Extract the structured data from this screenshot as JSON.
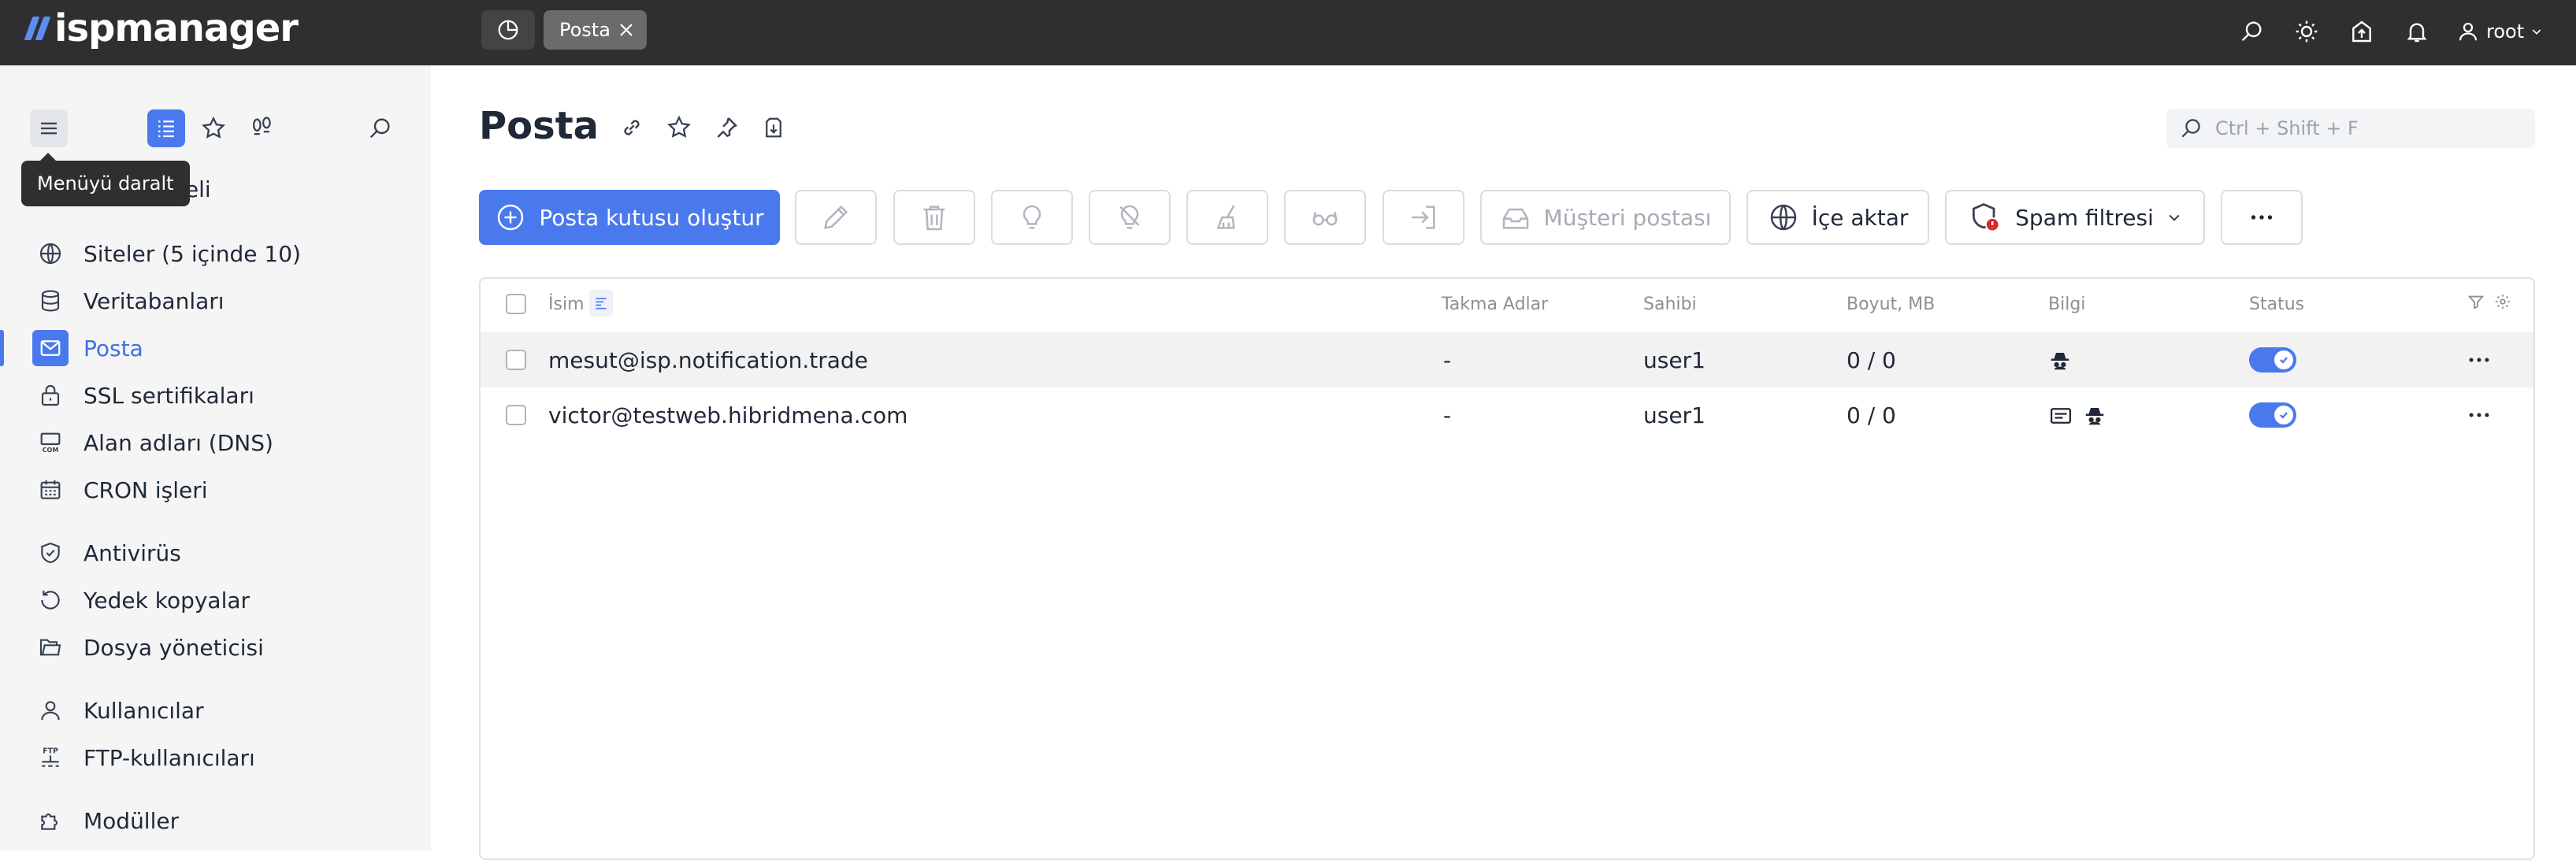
{
  "topbar": {
    "logo_text": "ispmanager",
    "active_tab": "Posta",
    "user_name": "root"
  },
  "sidebar": {
    "tooltip": "Menüyü daralt",
    "panel_label_partial": "aneli",
    "items": [
      {
        "label": "Siteler (5 içinde 10)",
        "icon": "globe-icon"
      },
      {
        "label": "Veritabanları",
        "icon": "database-icon"
      },
      {
        "label": "Posta",
        "icon": "mail-icon",
        "active": true
      },
      {
        "label": "SSL sertifikaları",
        "icon": "lock-icon"
      },
      {
        "label": "Alan adları (DNS)",
        "icon": "dns-icon"
      },
      {
        "label": "CRON işleri",
        "icon": "calendar-icon"
      },
      {
        "label": "Antivirüs",
        "icon": "shield-check-icon"
      },
      {
        "label": "Yedek kopyalar",
        "icon": "backup-icon"
      },
      {
        "label": "Dosya yöneticisi",
        "icon": "folder-icon"
      },
      {
        "label": "Kullanıcılar",
        "icon": "user-icon"
      },
      {
        "label": "FTP-kullanıcıları",
        "icon": "ftp-icon"
      },
      {
        "label": "Modüller",
        "icon": "puzzle-icon"
      }
    ]
  },
  "page": {
    "title": "Posta",
    "search_placeholder": "Ctrl + Shift + F"
  },
  "toolbar": {
    "create_label": "Posta kutusu oluştur",
    "client_mail_label": "Müşteri postası",
    "import_label": "İçe aktar",
    "spam_label": "Spam filtresi"
  },
  "table": {
    "headers": {
      "name": "İsim",
      "aliases": "Takma Adlar",
      "owner": "Sahibi",
      "size": "Boyut, MB",
      "info": "Bilgi",
      "status": "Status"
    },
    "rows": [
      {
        "name": "mesut@isp.notification.trade",
        "aliases": "-",
        "owner": "user1",
        "size": "0 / 0",
        "status_on": true
      },
      {
        "name": "victor@testweb.hibridmena.com",
        "aliases": "-",
        "owner": "user1",
        "size": "0 / 0",
        "status_on": true
      }
    ]
  },
  "colors": {
    "accent": "#4a79ee",
    "topbar": "#2f2f31",
    "sidebar": "#f5f5f6"
  }
}
